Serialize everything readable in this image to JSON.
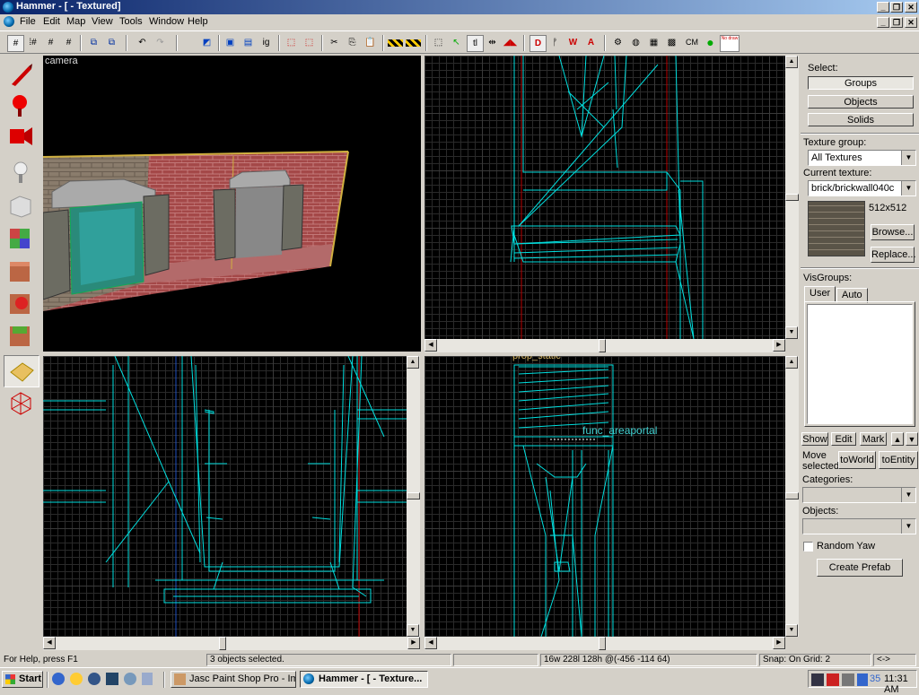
{
  "window": {
    "title": "Hammer - [ - Textured]",
    "caption_buttons": {
      "minimize": "_",
      "restore": "❐",
      "close": "✕"
    }
  },
  "menu": [
    "File",
    "Edit",
    "Map",
    "View",
    "Tools",
    "Window",
    "Help"
  ],
  "toolbar": {
    "cm_label": "CM",
    "nodraw_label": "No draw"
  },
  "viewports": {
    "camera_label": "camera",
    "side_label": "prop_static",
    "entity_label": "func_areaportal"
  },
  "panel": {
    "select_label": "Select:",
    "groups": "Groups",
    "objects": "Objects",
    "solids": "Solids",
    "texture_group_label": "Texture group:",
    "texture_group_value": "All Textures",
    "current_texture_label": "Current texture:",
    "current_texture_value": "brick/brickwall040c",
    "texture_size": "512x512",
    "browse": "Browse...",
    "replace": "Replace...",
    "visgroups_label": "VisGroups:",
    "tab_user": "User",
    "tab_auto": "Auto",
    "show": "Show",
    "edit": "Edit",
    "mark": "Mark",
    "move_selected_label": "Move\nselected:",
    "to_world": "toWorld",
    "to_entity": "toEntity",
    "categories_label": "Categories:",
    "objects_label": "Objects:",
    "random_yaw": "Random Yaw",
    "create_prefab": "Create Prefab"
  },
  "status": {
    "help": "For Help, press F1",
    "selection": "3 objects selected.",
    "dimensions": "16w 228l 128h @(-456 -114 64)",
    "snap": "Snap: On Grid: 2",
    "arrows": "<->"
  },
  "taskbar": {
    "start": "Start",
    "tasks": [
      "Jasc Paint Shop Pro - Im...",
      "Hammer - [ - Texture..."
    ],
    "tray_number": "35",
    "clock": "11:31 AM"
  },
  "colors": {
    "titlebar_start": "#0a246a",
    "titlebar_end": "#a6caf0",
    "face": "#d4d0c8",
    "wireframe": "#00e0e0"
  }
}
